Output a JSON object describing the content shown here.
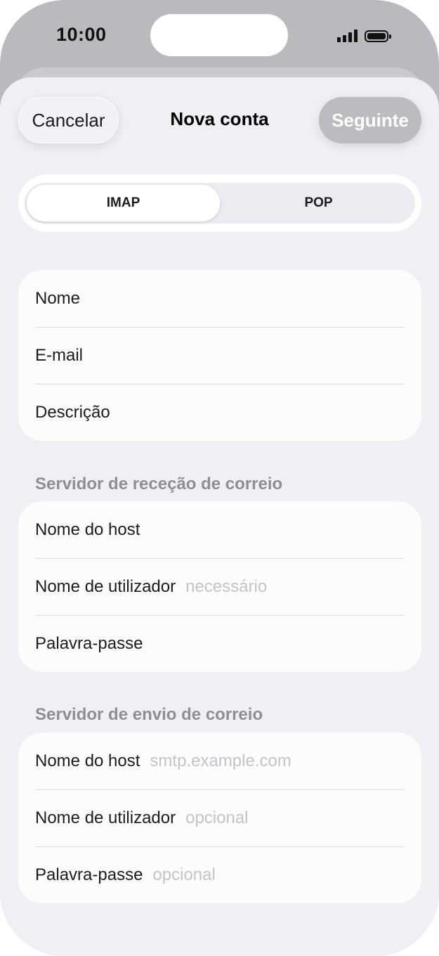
{
  "status_bar": {
    "time": "10:00",
    "icons": [
      "cellular-signal-icon",
      "battery-icon"
    ]
  },
  "nav": {
    "cancel_label": "Cancelar",
    "title": "Nova conta",
    "next_label": "Seguinte",
    "next_enabled": false
  },
  "segmented": {
    "options": [
      "IMAP",
      "POP"
    ],
    "selected": "IMAP"
  },
  "account": {
    "rows": [
      {
        "label": "Nome",
        "placeholder": ""
      },
      {
        "label": "E-mail",
        "placeholder": ""
      },
      {
        "label": "Descrição",
        "placeholder": ""
      }
    ]
  },
  "incoming": {
    "header": "Servidor de receção de correio",
    "rows": [
      {
        "label": "Nome do host",
        "placeholder": ""
      },
      {
        "label": "Nome de utilizador",
        "placeholder": "necessário"
      },
      {
        "label": "Palavra-passe",
        "placeholder": ""
      }
    ]
  },
  "outgoing": {
    "header": "Servidor de envio de correio",
    "rows": [
      {
        "label": "Nome do host",
        "placeholder": "smtp.example.com"
      },
      {
        "label": "Nome de utilizador",
        "placeholder": "opcional"
      },
      {
        "label": "Palavra-passe",
        "placeholder": "opcional"
      }
    ]
  },
  "colors": {
    "accent_disabled": "#bcbcc0",
    "background": "#efeff4",
    "placeholder": "#c4c4c8",
    "section_header": "#8e8e93"
  }
}
